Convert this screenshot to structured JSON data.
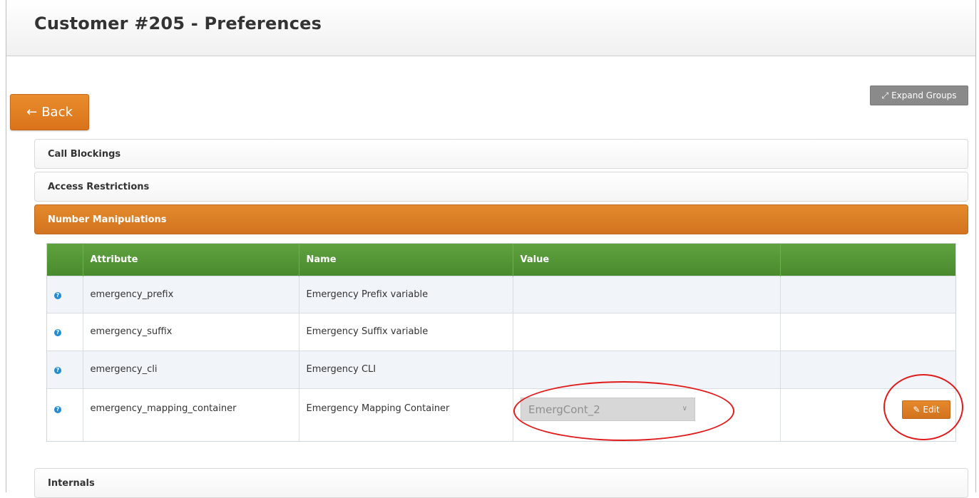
{
  "page": {
    "title": "Customer #205 - Preferences"
  },
  "toolbar": {
    "back_label": "Back",
    "expand_label": "Expand Groups"
  },
  "groups": [
    {
      "label": "Call Blockings"
    },
    {
      "label": "Access Restrictions"
    },
    {
      "label": "Number Manipulations"
    },
    {
      "label": "Internals"
    }
  ],
  "table": {
    "headers": [
      "Attribute",
      "Name",
      "Value"
    ],
    "rows": [
      {
        "attribute": "emergency_prefix",
        "name": "Emergency Prefix variable",
        "value": ""
      },
      {
        "attribute": "emergency_suffix",
        "name": "Emergency Suffix variable",
        "value": ""
      },
      {
        "attribute": "emergency_cli",
        "name": "Emergency CLI",
        "value": ""
      },
      {
        "attribute": "emergency_mapping_container",
        "name": "Emergency Mapping Container",
        "value": "EmergCont_2"
      }
    ],
    "edit_label": "Edit"
  },
  "colors": {
    "accent_orange": "#d9731a",
    "table_header_green": "#4a8a2e",
    "highlight_red": "#e01b1b"
  },
  "icons": {
    "back": "arrow-left-icon",
    "expand": "expand-arrows-icon",
    "info": "question-circle-icon",
    "edit": "edit-square-icon",
    "dropdown": "chevron-down-icon"
  }
}
